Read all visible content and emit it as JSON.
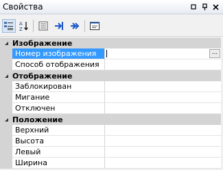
{
  "window": {
    "title": "Свойства"
  },
  "toolbar": {
    "tools": [
      "categorized-icon",
      "alphabetical-icon",
      "properties-icon",
      "events-icon",
      "methods-icon",
      "property-pages-icon"
    ]
  },
  "grid": {
    "categories": [
      {
        "label": "Изображение",
        "properties": [
          {
            "name": "Номер изображения",
            "value": "",
            "selected": true
          },
          {
            "name": "Способ отображения",
            "value": ""
          }
        ]
      },
      {
        "label": "Отображение",
        "properties": [
          {
            "name": "Заблокирован",
            "value": ""
          },
          {
            "name": "Мигание",
            "value": ""
          },
          {
            "name": "Отключен",
            "value": ""
          }
        ]
      },
      {
        "label": "Положение",
        "properties": [
          {
            "name": "Верхний",
            "value": ""
          },
          {
            "name": "Высота",
            "value": ""
          },
          {
            "name": "Левый",
            "value": ""
          },
          {
            "name": "Ширина",
            "value": ""
          }
        ]
      }
    ],
    "ellipsis_label": "..."
  }
}
